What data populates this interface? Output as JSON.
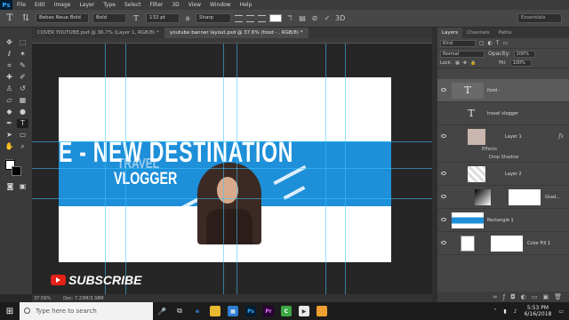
{
  "menubar": {
    "logo": "Ps",
    "items": [
      "File",
      "Edit",
      "Image",
      "Layer",
      "Type",
      "Select",
      "Filter",
      "3D",
      "View",
      "Window",
      "Help"
    ]
  },
  "options": {
    "font_family": "Bebas Neue Bold",
    "font_style": "Bold",
    "font_size": "132 pt",
    "antialias": "Sharp",
    "workspace": "Essentials"
  },
  "tabs": [
    {
      "label": "COVER YOUTUBE.psd @ 36.7% (Layer 1, RGB/8) *"
    },
    {
      "label": "youtube banner layout.psd @ 37.6% (food - , RGB/8) *"
    }
  ],
  "canvas": {
    "headline": "E - NEW DESTINATION",
    "travel": "TRAVEL",
    "vlogger": "VLOGGER",
    "subscribe": "SUBSCRIBE"
  },
  "statusbar": {
    "zoom": "37.59%",
    "doc": "Doc: 7.23M/3.38M"
  },
  "layers_panel": {
    "tabs": [
      "Layers",
      "Channels",
      "Paths"
    ],
    "filter_kind": "Kind",
    "blend_mode": "Normal",
    "opacity_label": "Opacity:",
    "opacity": "100%",
    "lock_label": "Lock:",
    "fill_label": "Fill:",
    "fill": "100%",
    "layers": [
      {
        "name": "food -"
      },
      {
        "name": "travel vlogger"
      },
      {
        "name": "Layer 1"
      },
      {
        "name": "Layer 2"
      },
      {
        "name": "Grad..."
      },
      {
        "name": "Rectangle 1"
      },
      {
        "name": "Color Fill 1"
      }
    ],
    "effects_label": "Effects",
    "drop_shadow_label": "Drop Shadow"
  },
  "taskbar": {
    "search_placeholder": "Type here to search",
    "time": "5:53 PM",
    "date": "6/16/2018"
  },
  "colors": {
    "accent_blue": "#1e8fd9",
    "youtube_red": "#e62117"
  }
}
